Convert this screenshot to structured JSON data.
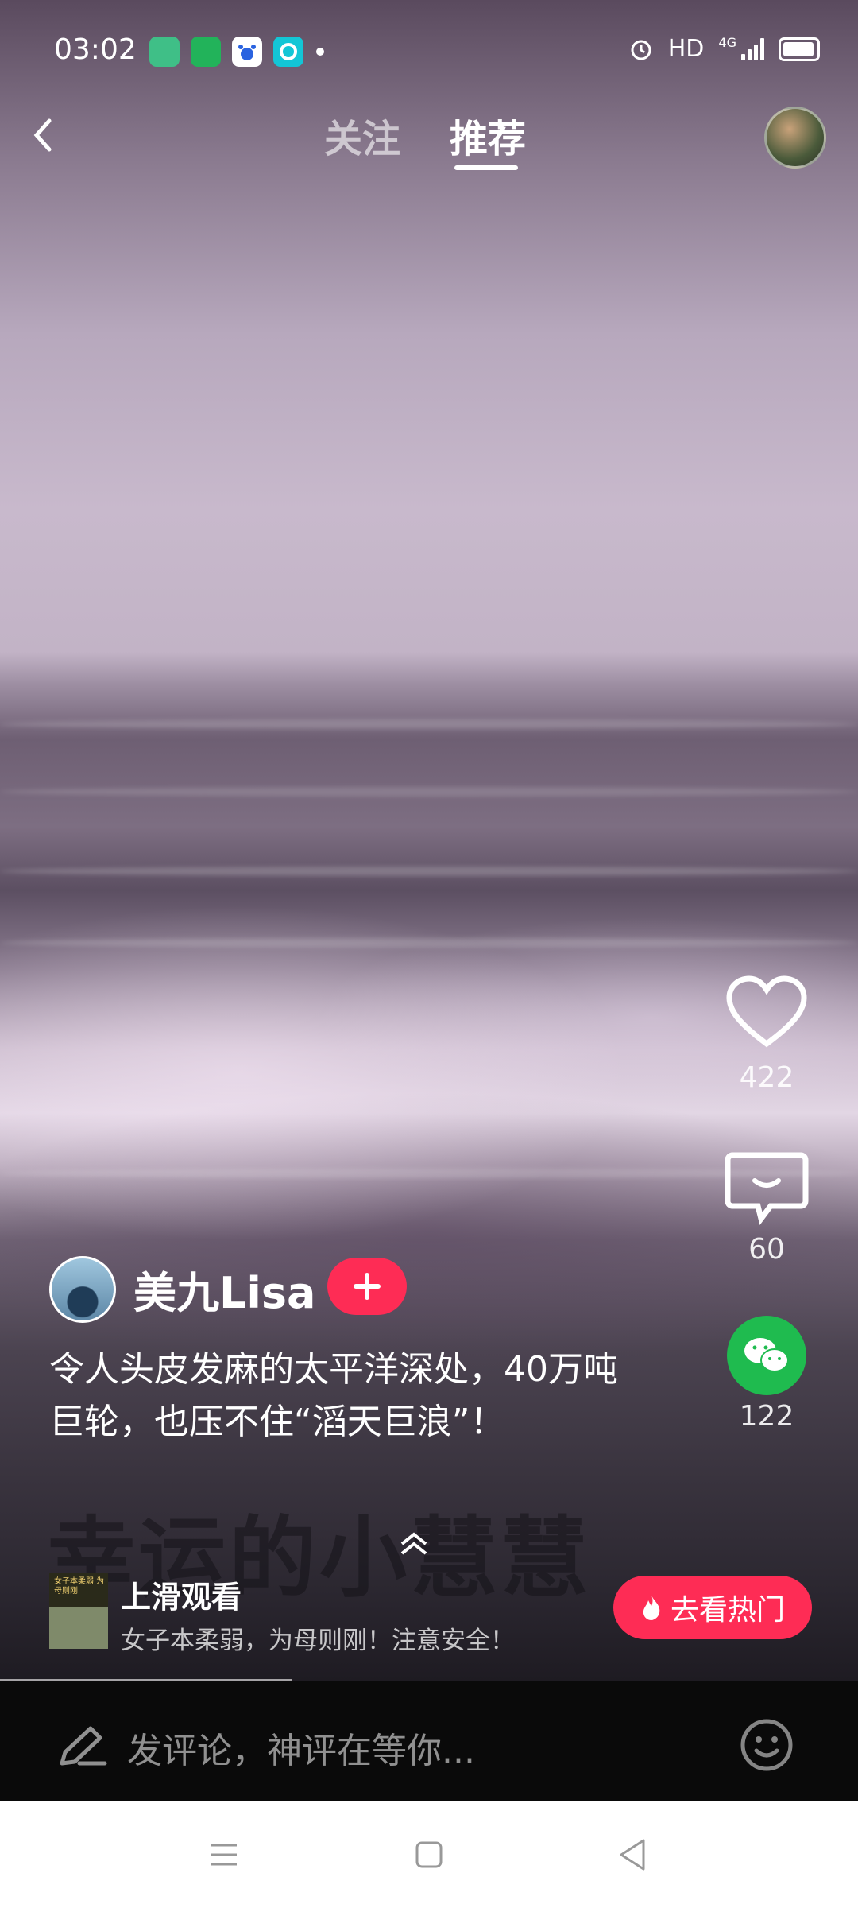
{
  "status_bar": {
    "time": "03:02",
    "hd_label": "HD",
    "network_label": "4G",
    "app_icons": [
      "green-square-app-icon",
      "green-ring-app-icon",
      "baidu-paw-app-icon",
      "cyan-app-icon"
    ]
  },
  "top_nav": {
    "tabs": [
      {
        "label": "关注",
        "active": false
      },
      {
        "label": "推荐",
        "active": true
      }
    ]
  },
  "actions": {
    "like_count": "422",
    "comment_count": "60",
    "share_count": "122"
  },
  "video": {
    "author": "美九Lisa",
    "caption_line1": "令人头皮发麻的太平洋深处，40万吨",
    "caption_line2": "巨轮，也压不住“滔天巨浪”！",
    "watermark": "幸运的小慧慧"
  },
  "promo": {
    "thumb_text": "女子本柔弱 为母则刚",
    "title": "上滑观看",
    "subtitle": "女子本柔弱，为母则刚！注意安全！",
    "hot_button": "去看热门"
  },
  "comment_bar": {
    "placeholder": "发评论，神评在等你..."
  },
  "colors": {
    "accent": "#fe2c55",
    "wechat": "#1fbb4f"
  }
}
